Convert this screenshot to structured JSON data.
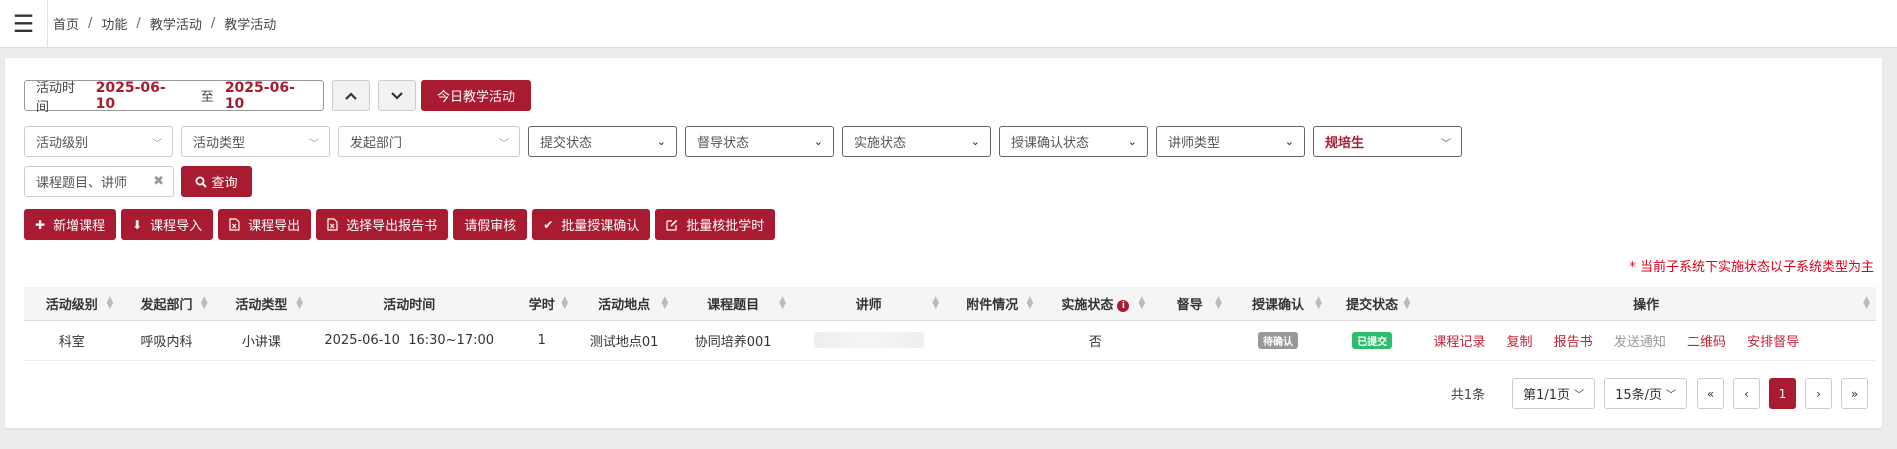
{
  "breadcrumb": [
    "首页",
    "功能",
    "教学活动",
    "教学活动"
  ],
  "breadcrumb_sep": "/",
  "date_filter": {
    "label": "活动时间",
    "start": "2025-06-10",
    "to_label": "至",
    "end": "2025-06-10"
  },
  "buttons": {
    "today": "今日教学活动",
    "query": "查询"
  },
  "filters": {
    "level": "活动级别",
    "type": "活动类型",
    "dept": "发起部门",
    "submit_status": "提交状态",
    "supervise_status": "督导状态",
    "impl_status": "实施状态",
    "confirm_status": "授课确认状态",
    "lecturer_type": "讲师类型",
    "trainee": "规培生"
  },
  "search": {
    "placeholder": "课程题目、讲师"
  },
  "actions": [
    "新增课程",
    "课程导入",
    "课程导出",
    "选择导出报告书",
    "请假审核",
    "批量授课确认",
    "批量核批学时"
  ],
  "notice": "* 当前子系统下实施状态以子系统类型为主",
  "table": {
    "headers": [
      "活动级别",
      "发起部门",
      "活动类型",
      "活动时间",
      "学时",
      "活动地点",
      "课程题目",
      "讲师",
      "附件情况",
      "实施状态",
      "督导",
      "授课确认",
      "提交状态",
      "操作"
    ],
    "rows": [
      {
        "level": "科室",
        "dept": "呼吸内科",
        "type": "小讲课",
        "time": "2025-06-10  16:30~17:00",
        "hours": "1",
        "place": "测试地点01",
        "title": "协同培养001",
        "attach": "",
        "impl": "否",
        "supervise": "",
        "confirm": "待确认",
        "submit": "已提交",
        "ops": [
          "课程记录",
          "复制",
          "报告书",
          "发送通知",
          "二维码",
          "安排督导"
        ]
      }
    ]
  },
  "pager": {
    "total": "共1条",
    "page": "第1/1页",
    "size": "15条/页",
    "current": "1",
    "first": "«",
    "prev": "‹",
    "next": "›",
    "last": "»"
  },
  "colors": {
    "primary": "#a81b31",
    "success": "#2ebc6e",
    "notice": "#e0001b"
  }
}
